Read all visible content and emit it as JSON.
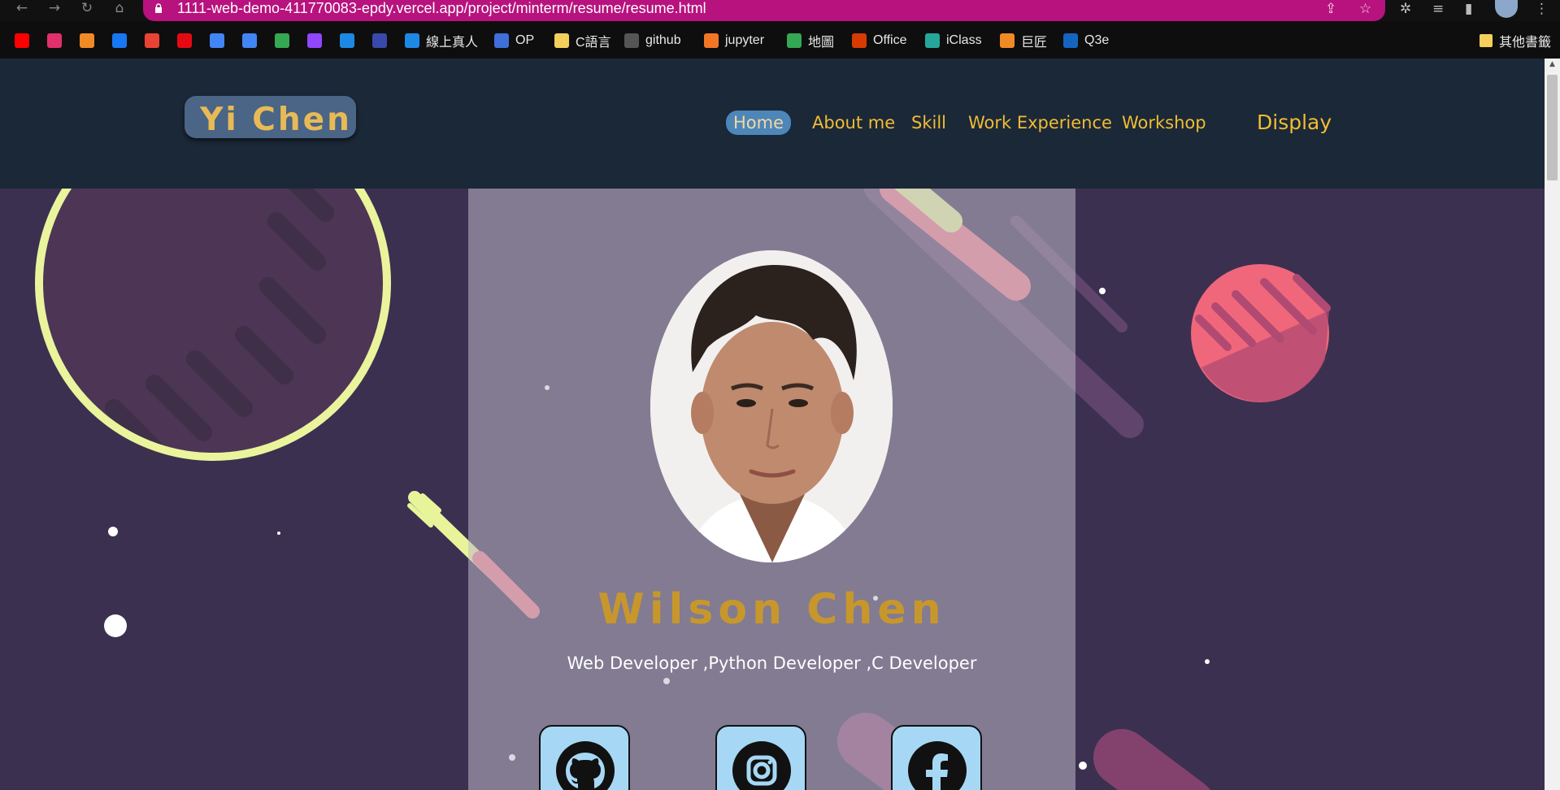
{
  "browser": {
    "url": "1111-web-demo-411770083-epdy.vercel.app/project/minterm/resume/resume.html",
    "bookmarks": [
      {
        "label": "",
        "color": "#ff0000"
      },
      {
        "label": "",
        "color": "#e1306c"
      },
      {
        "label": "",
        "color": "#f08a24"
      },
      {
        "label": "",
        "color": "#1877f2"
      },
      {
        "label": "",
        "color": "#ea4335"
      },
      {
        "label": "",
        "color": "#e50914"
      },
      {
        "label": "",
        "color": "#4285f4"
      },
      {
        "label": "",
        "color": "#4285f4"
      },
      {
        "label": "",
        "color": "#34a853"
      },
      {
        "label": "",
        "color": "#9146ff"
      },
      {
        "label": "",
        "color": "#1e88e5"
      },
      {
        "label": "",
        "color": "#3949ab"
      },
      {
        "label": "線上真人",
        "color": "#1e88e5"
      },
      {
        "label": "OP",
        "color": "#3f6fd8"
      },
      {
        "label": "C語言",
        "color": "#f5cf5b"
      },
      {
        "label": "github",
        "color": "#555555"
      },
      {
        "label": "jupyter",
        "color": "#f37626"
      },
      {
        "label": "地圖",
        "color": "#34a853"
      },
      {
        "label": "Office",
        "color": "#d83b01"
      },
      {
        "label": "iClass",
        "color": "#26a69a"
      },
      {
        "label": "巨匠",
        "color": "#f08a24"
      },
      {
        "label": "Q3e",
        "color": "#1565c0"
      }
    ],
    "other_bookmarks": "其他書籤"
  },
  "site": {
    "logo": "Yi Chen",
    "nav": [
      "Home",
      "About me",
      "Skill",
      "Work Experience",
      "Workshop",
      "Display"
    ],
    "active_nav": "Home"
  },
  "profile": {
    "name": "Wilson Chen",
    "role": "Web Developer ,Python Developer ,C Developer",
    "social": [
      "github-icon",
      "instagram-icon",
      "facebook-icon"
    ]
  },
  "colors": {
    "header_bg": "#1b2838",
    "page_bg": "#3b3050",
    "accent": "#f1bc33",
    "address_bar": "#b8127e"
  }
}
